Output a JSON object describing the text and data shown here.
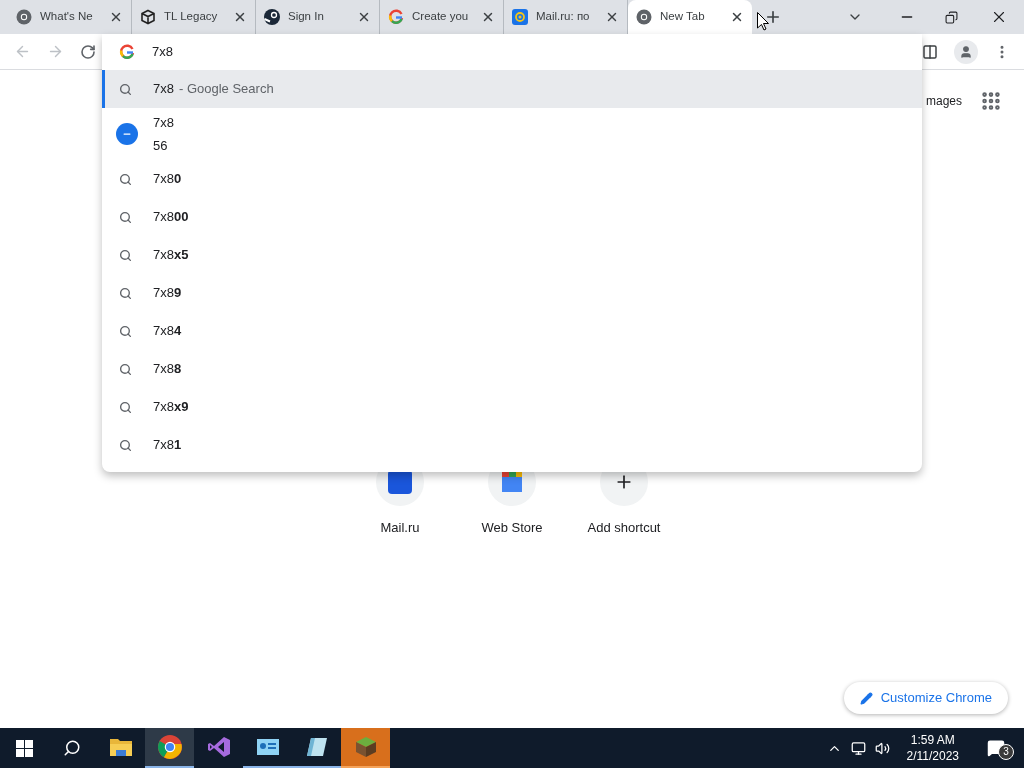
{
  "tabs": [
    {
      "title": "What's Ne",
      "kind": "chrome",
      "selected": false
    },
    {
      "title": "TL Legacy",
      "kind": "cube",
      "selected": false
    },
    {
      "title": "Sign In",
      "kind": "steam",
      "selected": false
    },
    {
      "title": "Create you",
      "kind": "google",
      "selected": false
    },
    {
      "title": "Mail.ru: по",
      "kind": "mail",
      "selected": false
    },
    {
      "title": "New Tab",
      "kind": "chrome",
      "selected": true
    }
  ],
  "omnibox": {
    "value": "7x8"
  },
  "suggestions": [
    {
      "kind": "search",
      "text": "7x8",
      "suffix": "- Google Search",
      "selected": true
    },
    {
      "kind": "calculator",
      "text": "7x8",
      "result": "56",
      "selected": false
    },
    {
      "kind": "search",
      "text": "7x8**0**",
      "selected": false
    },
    {
      "kind": "search",
      "text": "7x8**00**",
      "selected": false
    },
    {
      "kind": "search",
      "text": "7x8**x5**",
      "selected": false
    },
    {
      "kind": "search",
      "text": "7x8**9**",
      "selected": false
    },
    {
      "kind": "search",
      "text": "7x8**4**",
      "selected": false
    },
    {
      "kind": "search",
      "text": "7x8**8**",
      "selected": false
    },
    {
      "kind": "search",
      "text": "7x8**x9**",
      "selected": false
    },
    {
      "kind": "search",
      "text": "7x8**1**",
      "selected": false
    }
  ],
  "page": {
    "header_link": "mages",
    "shortcuts": [
      {
        "title": "Mail.ru",
        "kind": "mail"
      },
      {
        "title": "Web Store",
        "kind": "store"
      },
      {
        "title": "Add shortcut",
        "kind": "add"
      }
    ],
    "customize_button": "Customize Chrome"
  },
  "taskbar": {
    "apps": [
      {
        "kind": "folder",
        "selected": false,
        "running": false,
        "flashing": false
      },
      {
        "kind": "chrome",
        "selected": true,
        "running": true,
        "flashing": false
      },
      {
        "kind": "vs",
        "selected": false,
        "running": false,
        "flashing": false
      },
      {
        "kind": "panel",
        "selected": false,
        "running": true,
        "flashing": false
      },
      {
        "kind": "notepad",
        "selected": false,
        "running": true,
        "flashing": false
      },
      {
        "kind": "block",
        "selected": false,
        "running": true,
        "flashing": true
      }
    ],
    "time": "1:59 AM",
    "date": "2/11/2023",
    "notifications": "3"
  }
}
